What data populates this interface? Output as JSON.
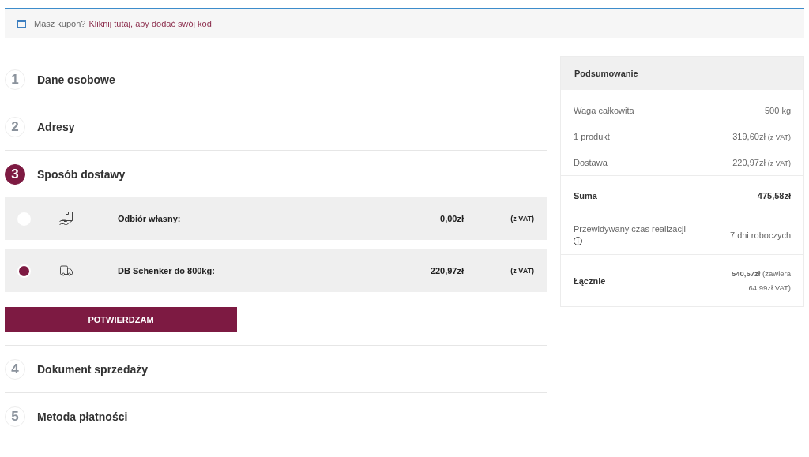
{
  "coupon": {
    "prompt": "Masz kupon?",
    "link": "Kliknij tutaj, aby dodać swój kod"
  },
  "steps": [
    {
      "number": "1",
      "title": "Dane osobowe",
      "active": false
    },
    {
      "number": "2",
      "title": "Adresy",
      "active": false
    },
    {
      "number": "3",
      "title": "Sposób dostawy",
      "active": true,
      "shipping_options": [
        {
          "kind": "pickup",
          "label": "Odbiór własny:",
          "price": "0,00zł",
          "tax_note": "(z VAT)",
          "selected": false
        },
        {
          "kind": "courier",
          "label": "DB Schenker do 800kg:",
          "price": "220,97zł",
          "tax_note": "(z VAT)",
          "selected": true
        }
      ],
      "confirm_button": "POTWIERDZAM"
    },
    {
      "number": "4",
      "title": "Dokument sprzedaży",
      "active": false
    },
    {
      "number": "5",
      "title": "Metoda płatności",
      "active": false
    }
  ],
  "summary": {
    "title": "Podsumowanie",
    "sections": [
      {
        "rows": [
          {
            "kind": "plain",
            "label": "Waga całkowita",
            "value": "500 kg"
          },
          {
            "kind": "plain",
            "label": "1 produkt",
            "value": "319,60zł",
            "note": "(z VAT)"
          },
          {
            "kind": "plain",
            "label": "Dostawa",
            "value": "220,97zł",
            "note": "(z VAT)"
          }
        ]
      },
      {
        "rows": [
          {
            "kind": "total",
            "label": "Suma",
            "value": "475,58zł"
          }
        ]
      },
      {
        "rows": [
          {
            "kind": "info",
            "label": "Przewidywany czas realizacji",
            "value": "7 dni roboczych"
          }
        ]
      },
      {
        "rows": [
          {
            "kind": "grand",
            "label": "Łącznie",
            "value": "**540,57zł** (zawiera 64,99zł VAT)"
          }
        ]
      }
    ]
  }
}
